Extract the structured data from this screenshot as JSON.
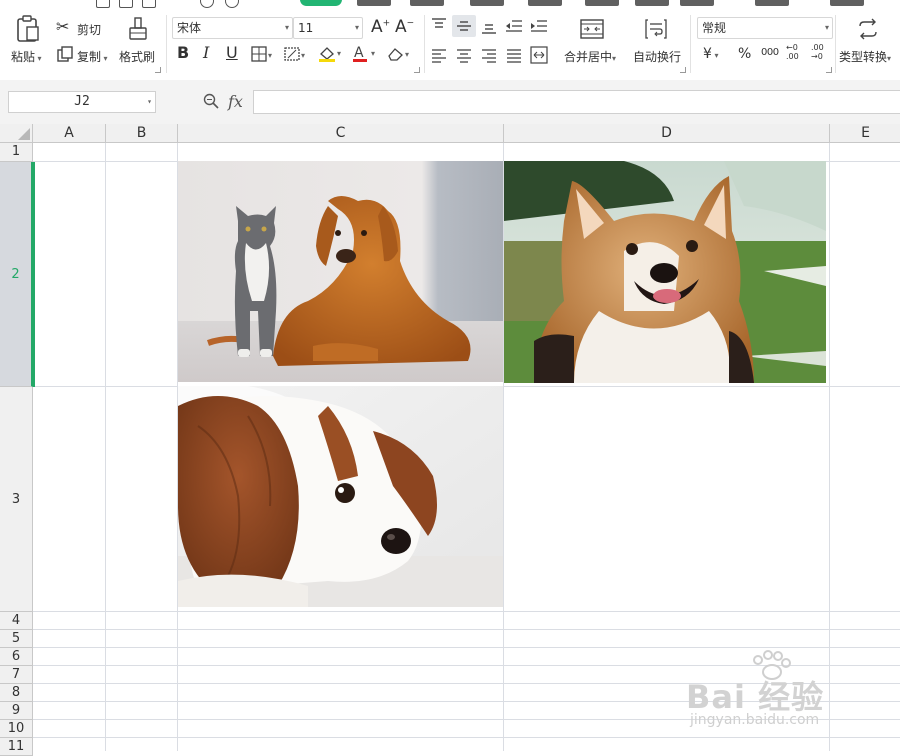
{
  "ribbon": {
    "paste": "粘贴",
    "cut": "剪切",
    "copy": "复制",
    "format_painter": "格式刷",
    "font_name": "宋体",
    "font_size": "11",
    "merge_center": "合并居中",
    "wrap_text": "自动换行",
    "number_format": "常规",
    "type_convert": "类型转换",
    "currency_symbol": "¥",
    "percent_symbol": "%",
    "thousands_symbol": "000",
    "dec_increase": "←0 .00",
    "dec_decrease": ".00 →0"
  },
  "formula_bar": {
    "cell_ref": "J2",
    "fx_label": "fx",
    "value": ""
  },
  "sheet": {
    "columns": [
      "A",
      "B",
      "C",
      "D",
      "E"
    ],
    "rows": [
      "1",
      "2",
      "3",
      "4",
      "5",
      "6",
      "7",
      "8",
      "9",
      "10",
      "11"
    ],
    "selected_row": "2",
    "images": [
      {
        "cell": "C2",
        "description": "gray-cat-and-golden-retriever"
      },
      {
        "cell": "D2",
        "description": "smiling-corgi-on-grass"
      },
      {
        "cell": "C3",
        "description": "cavalier-spaniel-lying-down"
      }
    ]
  },
  "watermark": {
    "text": "Bai 经验",
    "subtext": "jingyan.baidu.com"
  },
  "colors": {
    "accent_green": "#23a867",
    "header_bg": "#f0f0f0",
    "grid_line": "#dadde3"
  }
}
